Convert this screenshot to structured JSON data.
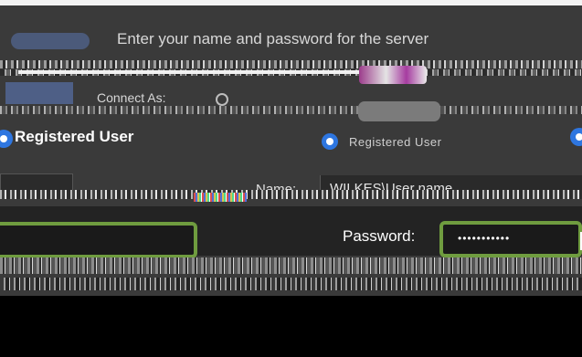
{
  "dialog": {
    "title": "Enter your name and password for the server",
    "connect_as_label": "Connect As:",
    "registered_user_label": "Registered User",
    "registered_user_small": "Registered User",
    "name_label": "Name:",
    "name_value": "WILKES\\User name",
    "password_label": "Password:",
    "password_value": "•••••••••••"
  },
  "colors": {
    "accent_focus": "#6f9c3f",
    "radio_blue": "#2e76e0",
    "dialog_bg": "#3a3a3a"
  }
}
